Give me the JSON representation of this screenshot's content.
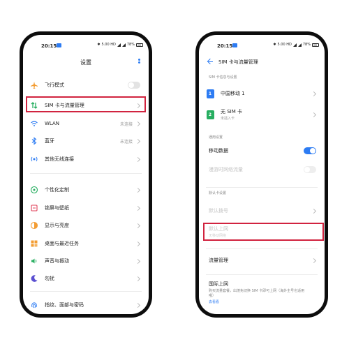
{
  "left_phone": {
    "status": {
      "time": "20:15",
      "indicators": "5.00 HD",
      "battery": "78%"
    },
    "title": "设置",
    "items": [
      {
        "icon": "airplane-icon",
        "label": "飞行模式",
        "value": ""
      },
      {
        "icon": "sim-traffic-icon",
        "label": "SIM 卡与流量管理",
        "value": ""
      },
      {
        "icon": "wifi-icon",
        "label": "WLAN",
        "value": "未连接"
      },
      {
        "icon": "bluetooth-icon",
        "label": "蓝牙",
        "value": "未连接"
      },
      {
        "icon": "wireless-icon",
        "label": "其他无线连接",
        "value": ""
      },
      {
        "icon": "personalize-icon",
        "label": "个性化定制",
        "value": ""
      },
      {
        "icon": "lockscreen-icon",
        "label": "锁屏与壁纸",
        "value": ""
      },
      {
        "icon": "display-icon",
        "label": "显示与亮度",
        "value": ""
      },
      {
        "icon": "desktop-icon",
        "label": "桌面与最近任务",
        "value": ""
      },
      {
        "icon": "sound-icon",
        "label": "声音与振动",
        "value": ""
      },
      {
        "icon": "moon-icon",
        "label": "勿扰",
        "value": ""
      },
      {
        "icon": "fingerprint-icon",
        "label": "指纹、面部与密码",
        "value": ""
      }
    ]
  },
  "right_phone": {
    "status": {
      "time": "20:15",
      "indicators": "5.00 HD",
      "battery": "78%"
    },
    "title": "SIM 卡与流量管理",
    "section_sim": "SIM 卡信息与设置",
    "sim1": {
      "badge": "1",
      "label": "中国移动 1",
      "sub": ""
    },
    "sim2": {
      "badge": "2",
      "label": "无 SIM 卡",
      "sub": "未插入卡"
    },
    "section_general": "通用设置",
    "mobile_data": "移动数据",
    "roaming": "漫游时网络流量",
    "section_default": "默认卡设置",
    "default_call": "默认拨号",
    "default_data": "默认上网",
    "default_data_sub": "无移动网络",
    "traffic": "流量管理",
    "intl": "国际上网",
    "intl_desc": "购买流量套餐，出境免切换 SIM 卡即可上网（海外主号也适用哦）",
    "intl_link": "去看看"
  },
  "colors": {
    "accent": "#2d7cf3",
    "highlight": "#d1233f"
  }
}
